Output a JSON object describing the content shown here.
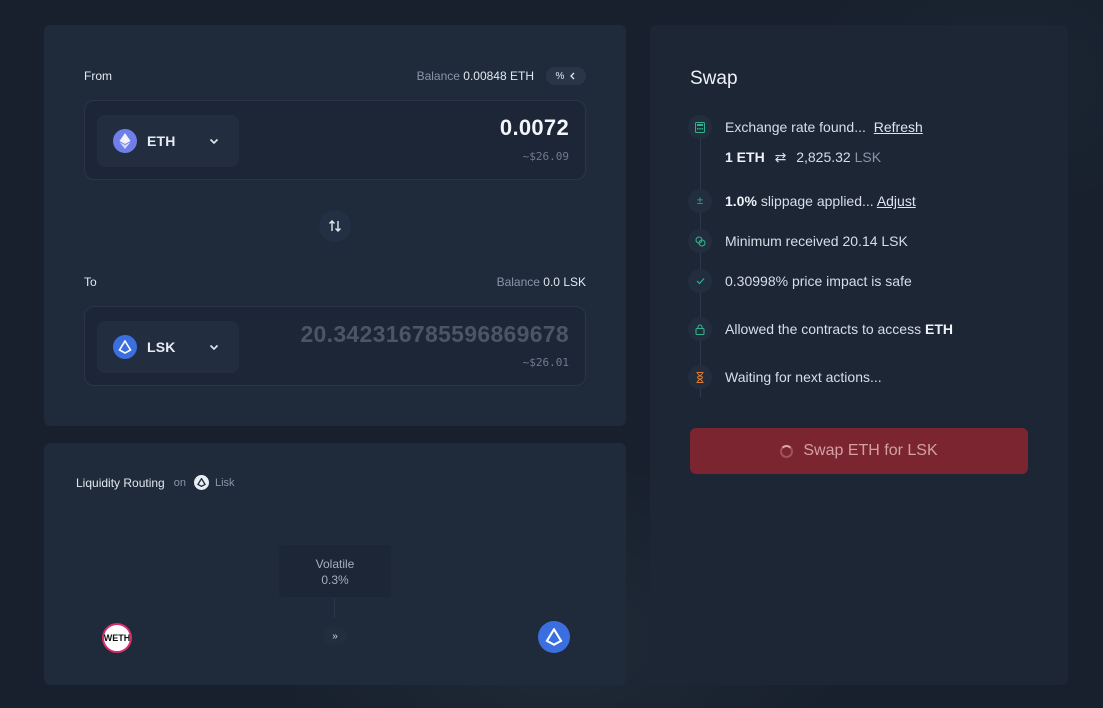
{
  "from": {
    "label": "From",
    "balance_label": "Balance",
    "balance_value": "0.00848 ETH",
    "percent_button": "%",
    "token": "ETH",
    "amount": "0.0072",
    "usd": "~$26.09"
  },
  "to": {
    "label": "To",
    "balance_label": "Balance",
    "balance_value": "0.0 LSK",
    "token": "LSK",
    "amount": "20.342316785596869678",
    "usd": "~$26.01"
  },
  "routing": {
    "title": "Liquidity Routing",
    "on": "on",
    "network": "Lisk",
    "pool_type": "Volatile",
    "pool_fee": "0.3%",
    "from_token_badge": "WETH"
  },
  "swap": {
    "title": "Swap",
    "steps": {
      "rate_text": "Exchange rate found...",
      "rate_link": "Refresh",
      "rate_base": "1 ETH",
      "rate_swap_symbol": "⇄",
      "rate_quote": "2,825.32",
      "rate_quote_unit": "LSK",
      "slippage_value": "1.0%",
      "slippage_text": "slippage applied...",
      "slippage_link": "Adjust",
      "min_received": "Minimum received 20.14 LSK",
      "price_impact": "0.30998% price impact is safe",
      "allowed_text": "Allowed the contracts to access",
      "allowed_token": "ETH",
      "waiting": "Waiting for next actions..."
    },
    "button_label": "Swap ETH for LSK"
  },
  "colors": {
    "background": "#17202c",
    "card": "#1f2a3a",
    "accent_green": "#2fb38a",
    "swap_button": "#7b2530",
    "eth": "#6f7ee8",
    "lisk": "#3b6fe0",
    "hourglass": "#e07a2e"
  }
}
